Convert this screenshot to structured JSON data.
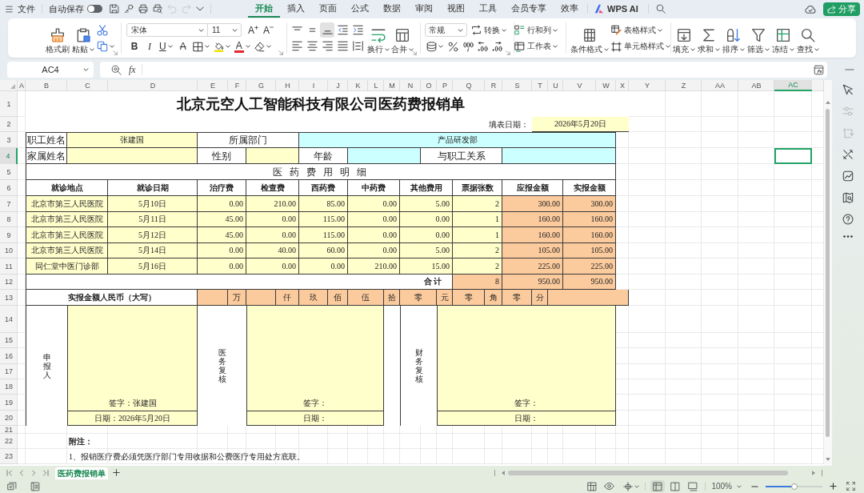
{
  "title_bar": {
    "file_menu": "文件",
    "autosave": {
      "label": "自动保存",
      "on": false
    },
    "undo": {
      "disabled": true
    },
    "redo": {
      "disabled": true
    },
    "tabs": [
      {
        "label": "开始",
        "selected": true
      },
      {
        "label": "插入",
        "selected": false
      },
      {
        "label": "页面",
        "selected": false
      },
      {
        "label": "公式",
        "selected": false
      },
      {
        "label": "数据",
        "selected": false
      },
      {
        "label": "审阅",
        "selected": false
      },
      {
        "label": "视图",
        "selected": false
      },
      {
        "label": "工具",
        "selected": false
      },
      {
        "label": "会员专享",
        "selected": false
      },
      {
        "label": "效率",
        "selected": false
      }
    ],
    "ai_button": "WPS AI",
    "share_button": "分享"
  },
  "ribbon": {
    "clipboard": {
      "format_painter": "格式刷",
      "paste": "粘贴"
    },
    "font": {
      "family": "宋体",
      "size": "11",
      "grow": "A",
      "shrink": "A",
      "bold": "B",
      "italic": "I",
      "underline": "U",
      "strikethrough": "A",
      "font_color": "A"
    },
    "alignment": {
      "vertical": [
        {
          "selected": false
        },
        {
          "selected": false
        },
        {
          "selected": true
        }
      ],
      "horizontal": [
        {
          "selected": false
        },
        {
          "selected": false
        },
        {
          "selected": false
        },
        {
          "selected": false
        },
        {
          "selected": false
        }
      ],
      "wrap_text": "换行",
      "merge": "合并"
    },
    "number": {
      "format": "常规",
      "convert": "转换"
    },
    "cells": {
      "rows_and_columns": "行和列",
      "worksheet": "工作表"
    },
    "styles": {
      "conditional_formatting": "条件格式",
      "table_style": "表格样式",
      "cell_style": "单元格样式"
    },
    "editing": [
      "填充",
      "求和",
      "排序",
      "筛选",
      "冻结",
      "查找"
    ]
  },
  "formula_bar": {
    "name_box": "AC4",
    "function_button": "fx"
  },
  "sheet": {
    "column_headers": [
      {
        "label": "A",
        "selected": false
      },
      {
        "label": "B",
        "selected": false
      },
      {
        "label": "C",
        "selected": false
      },
      {
        "label": "D",
        "selected": false
      },
      {
        "label": "E",
        "selected": false
      },
      {
        "label": "F",
        "selected": false
      },
      {
        "label": "G",
        "selected": false
      },
      {
        "label": "H",
        "selected": false
      },
      {
        "label": "I",
        "selected": false
      },
      {
        "label": "J",
        "selected": false
      },
      {
        "label": "K",
        "selected": false
      },
      {
        "label": "L",
        "selected": false
      },
      {
        "label": "M",
        "selected": false
      },
      {
        "label": "N",
        "selected": false
      },
      {
        "label": "O",
        "selected": false
      },
      {
        "label": "P",
        "selected": false
      },
      {
        "label": "Q",
        "selected": false
      },
      {
        "label": "R",
        "selected": false
      },
      {
        "label": "S",
        "selected": false
      },
      {
        "label": "T",
        "selected": false
      },
      {
        "label": "U",
        "selected": false
      },
      {
        "label": "V",
        "selected": false
      },
      {
        "label": "W",
        "selected": false
      },
      {
        "label": "X",
        "selected": false
      },
      {
        "label": "Y",
        "selected": false
      },
      {
        "label": "Z",
        "selected": false
      },
      {
        "label": "AA",
        "selected": false
      },
      {
        "label": "AB",
        "selected": false
      },
      {
        "label": "AC",
        "selected": true
      }
    ],
    "row_headers": [
      {
        "label": "1",
        "selected": false
      },
      {
        "label": "2",
        "selected": false
      },
      {
        "label": "3",
        "selected": false
      },
      {
        "label": "4",
        "selected": true
      },
      {
        "label": "5",
        "selected": false
      },
      {
        "label": "6",
        "selected": false
      },
      {
        "label": "7",
        "selected": false
      },
      {
        "label": "8",
        "selected": false
      },
      {
        "label": "9",
        "selected": false
      },
      {
        "label": "10",
        "selected": false
      },
      {
        "label": "11",
        "selected": false
      },
      {
        "label": "12",
        "selected": false
      },
      {
        "label": "13",
        "selected": false
      },
      {
        "label": "14",
        "selected": false
      },
      {
        "label": "15",
        "selected": false
      },
      {
        "label": "16",
        "selected": false
      },
      {
        "label": "17",
        "selected": false
      },
      {
        "label": "18",
        "selected": false
      },
      {
        "label": "19",
        "selected": false
      },
      {
        "label": "20",
        "selected": false
      },
      {
        "label": "21",
        "selected": false
      },
      {
        "label": "22",
        "selected": false
      },
      {
        "label": "23",
        "selected": false
      }
    ],
    "title": "北京元空人工智能科技有限公司医药费报销单",
    "fill_date": {
      "label": "填表日期：",
      "value": "2026年5月20日"
    },
    "employee": {
      "name_label": "职工姓名",
      "name": "张建国",
      "department_label": "所属部门",
      "department": "产品研发部"
    },
    "family": {
      "name_label": "家属姓名",
      "gender_label": "性别",
      "age_label": "年龄",
      "relation_label": "与职工关系"
    },
    "details_heading": "医 药 费 用 明 细",
    "columns": [
      "就诊地点",
      "就诊日期",
      "治疗费",
      "检查费",
      "西药费",
      "中药费",
      "其他费用",
      "票据张数",
      "应报金额",
      "实报金额"
    ],
    "rows": [
      [
        "北京市第三人民医院",
        "5月10日",
        "0.00",
        "210.00",
        "85.00",
        "0.00",
        "5.00",
        "2",
        "300.00",
        "300.00"
      ],
      [
        "北京市第三人民医院",
        "5月11日",
        "45.00",
        "0.00",
        "115.00",
        "0.00",
        "0.00",
        "1",
        "160.00",
        "160.00"
      ],
      [
        "北京市第三人民医院",
        "5月12日",
        "45.00",
        "0.00",
        "115.00",
        "0.00",
        "0.00",
        "1",
        "160.00",
        "160.00"
      ],
      [
        "北京市第三人民医院",
        "5月14日",
        "0.00",
        "40.00",
        "60.00",
        "0.00",
        "5.00",
        "2",
        "105.00",
        "105.00"
      ],
      [
        "同仁堂中医门诊部",
        "5月16日",
        "0.00",
        "0.00",
        "0.00",
        "210.00",
        "15.00",
        "2",
        "225.00",
        "225.00"
      ]
    ],
    "total": {
      "label": "合 计",
      "receipts": "8",
      "claimed": "950.00",
      "paid": "950.00"
    },
    "amount_in_words": {
      "label": "实报金额人民币（大写）",
      "cells": [
        "万",
        "仟",
        "玖",
        "佰",
        "伍",
        "拾",
        "零",
        "元",
        "零",
        "角",
        "零",
        "分"
      ]
    },
    "approvals": [
      {
        "role": "申报人",
        "signature": "签字：张建国",
        "date": "日期：2026年5月20日"
      },
      {
        "role": "医务复核",
        "signature": "签字：",
        "date": "日期："
      },
      {
        "role": "财务复核",
        "signature": "签字：",
        "date": "日期："
      }
    ],
    "notes_heading": "附注：",
    "notes": [
      "1、报销医疗费必须凭医疗部门专用收据和公费医疗专用处方底联。"
    ]
  },
  "sheet_tabs": [
    {
      "label": "医药费报销单",
      "selected": true
    }
  ],
  "status_bar": {
    "views": [
      {
        "selected": true
      },
      {
        "selected": false
      },
      {
        "selected": false
      }
    ],
    "zoom": "100%",
    "zoom_slider": {
      "level": 0.5
    }
  }
}
